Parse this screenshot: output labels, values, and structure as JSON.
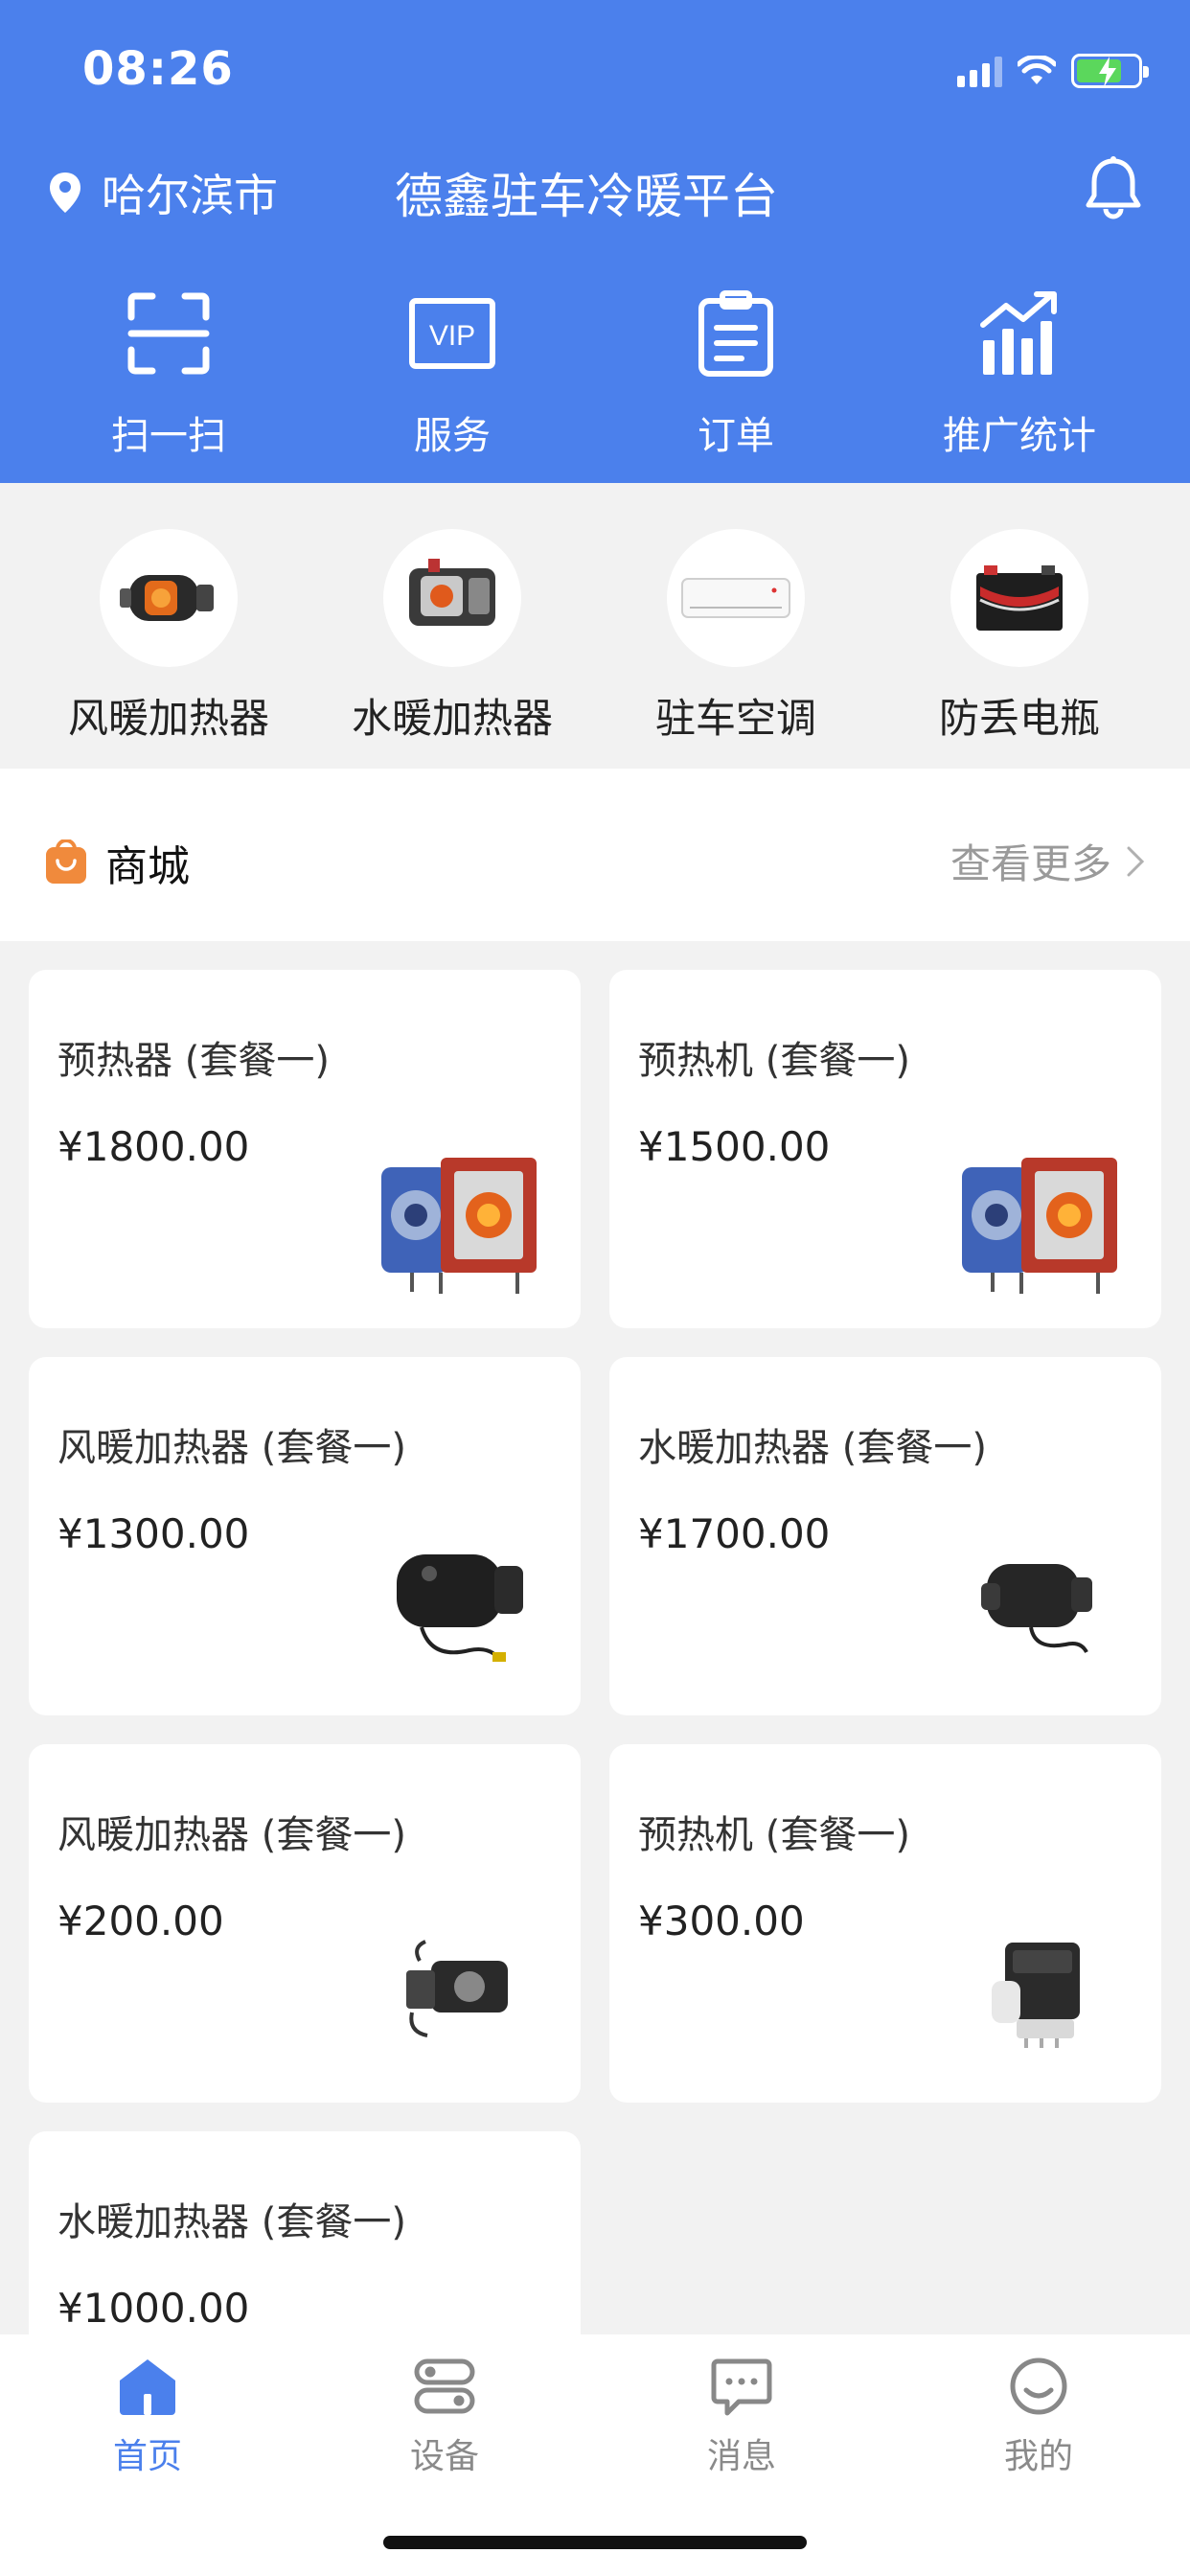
{
  "status_bar": {
    "time": "08:26"
  },
  "header": {
    "city": "哈尔滨市",
    "title": "德鑫驻车冷暖平台",
    "quick_nav": [
      {
        "label": "扫一扫",
        "icon": "scan-icon"
      },
      {
        "label": "服务",
        "icon": "vip-icon",
        "icon_text": "VIP"
      },
      {
        "label": "订单",
        "icon": "order-icon"
      },
      {
        "label": "推广统计",
        "icon": "stats-icon"
      }
    ]
  },
  "categories": [
    {
      "label": "风暖加热器",
      "icon": "air-heater-image"
    },
    {
      "label": "水暖加热器",
      "icon": "water-heater-image"
    },
    {
      "label": "驻车空调",
      "icon": "parking-ac-image"
    },
    {
      "label": "防丢电瓶",
      "icon": "battery-image"
    }
  ],
  "mall": {
    "title": "商城",
    "more": "查看更多",
    "products": [
      {
        "name": "预热器 (套餐一)",
        "price": "¥1800.00",
        "image": "preheater-cutaway"
      },
      {
        "name": "预热机 (套餐一)",
        "price": "¥1500.00",
        "image": "preheater-cutaway"
      },
      {
        "name": "风暖加热器 (套餐一)",
        "price": "¥1300.00",
        "image": "air-heater-black"
      },
      {
        "name": "水暖加热器 (套餐一)",
        "price": "¥1700.00",
        "image": "water-heater-black"
      },
      {
        "name": "风暖加热器 (套餐一)",
        "price": "¥200.00",
        "image": "pump-unit"
      },
      {
        "name": "预热机 (套餐一)",
        "price": "¥300.00",
        "image": "heater-unit-white"
      },
      {
        "name": "水暖加热器 (套餐一)",
        "price": "¥1000.00",
        "image": "hidden"
      }
    ]
  },
  "tabbar": {
    "tabs": [
      {
        "label": "首页",
        "icon": "home-icon",
        "active": true
      },
      {
        "label": "设备",
        "icon": "device-icon",
        "active": false
      },
      {
        "label": "消息",
        "icon": "message-icon",
        "active": false
      },
      {
        "label": "我的",
        "icon": "profile-icon",
        "active": false
      }
    ]
  },
  "colors": {
    "primary": "#4b80ec",
    "mall_icon": "#f08a3c",
    "muted": "#9a9a9a"
  }
}
